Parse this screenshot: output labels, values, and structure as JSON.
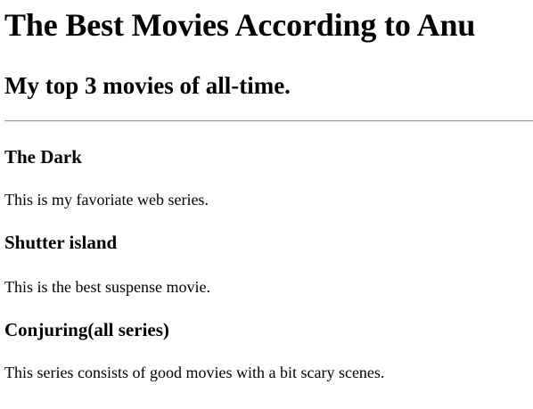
{
  "page": {
    "title": "The Best Movies According to Anu",
    "subtitle": "My top 3 movies of all-time."
  },
  "movies": [
    {
      "title": "The Dark",
      "description": "This is my favoriate web series."
    },
    {
      "title": "Shutter island",
      "description": "This is the best suspense movie."
    },
    {
      "title": "Conjuring(all series)",
      "description": "This series consists of good movies with a bit scary scenes."
    }
  ],
  "colors": {
    "background": "#ffffff",
    "text": "#000000",
    "divider": "#9a9a9a"
  }
}
